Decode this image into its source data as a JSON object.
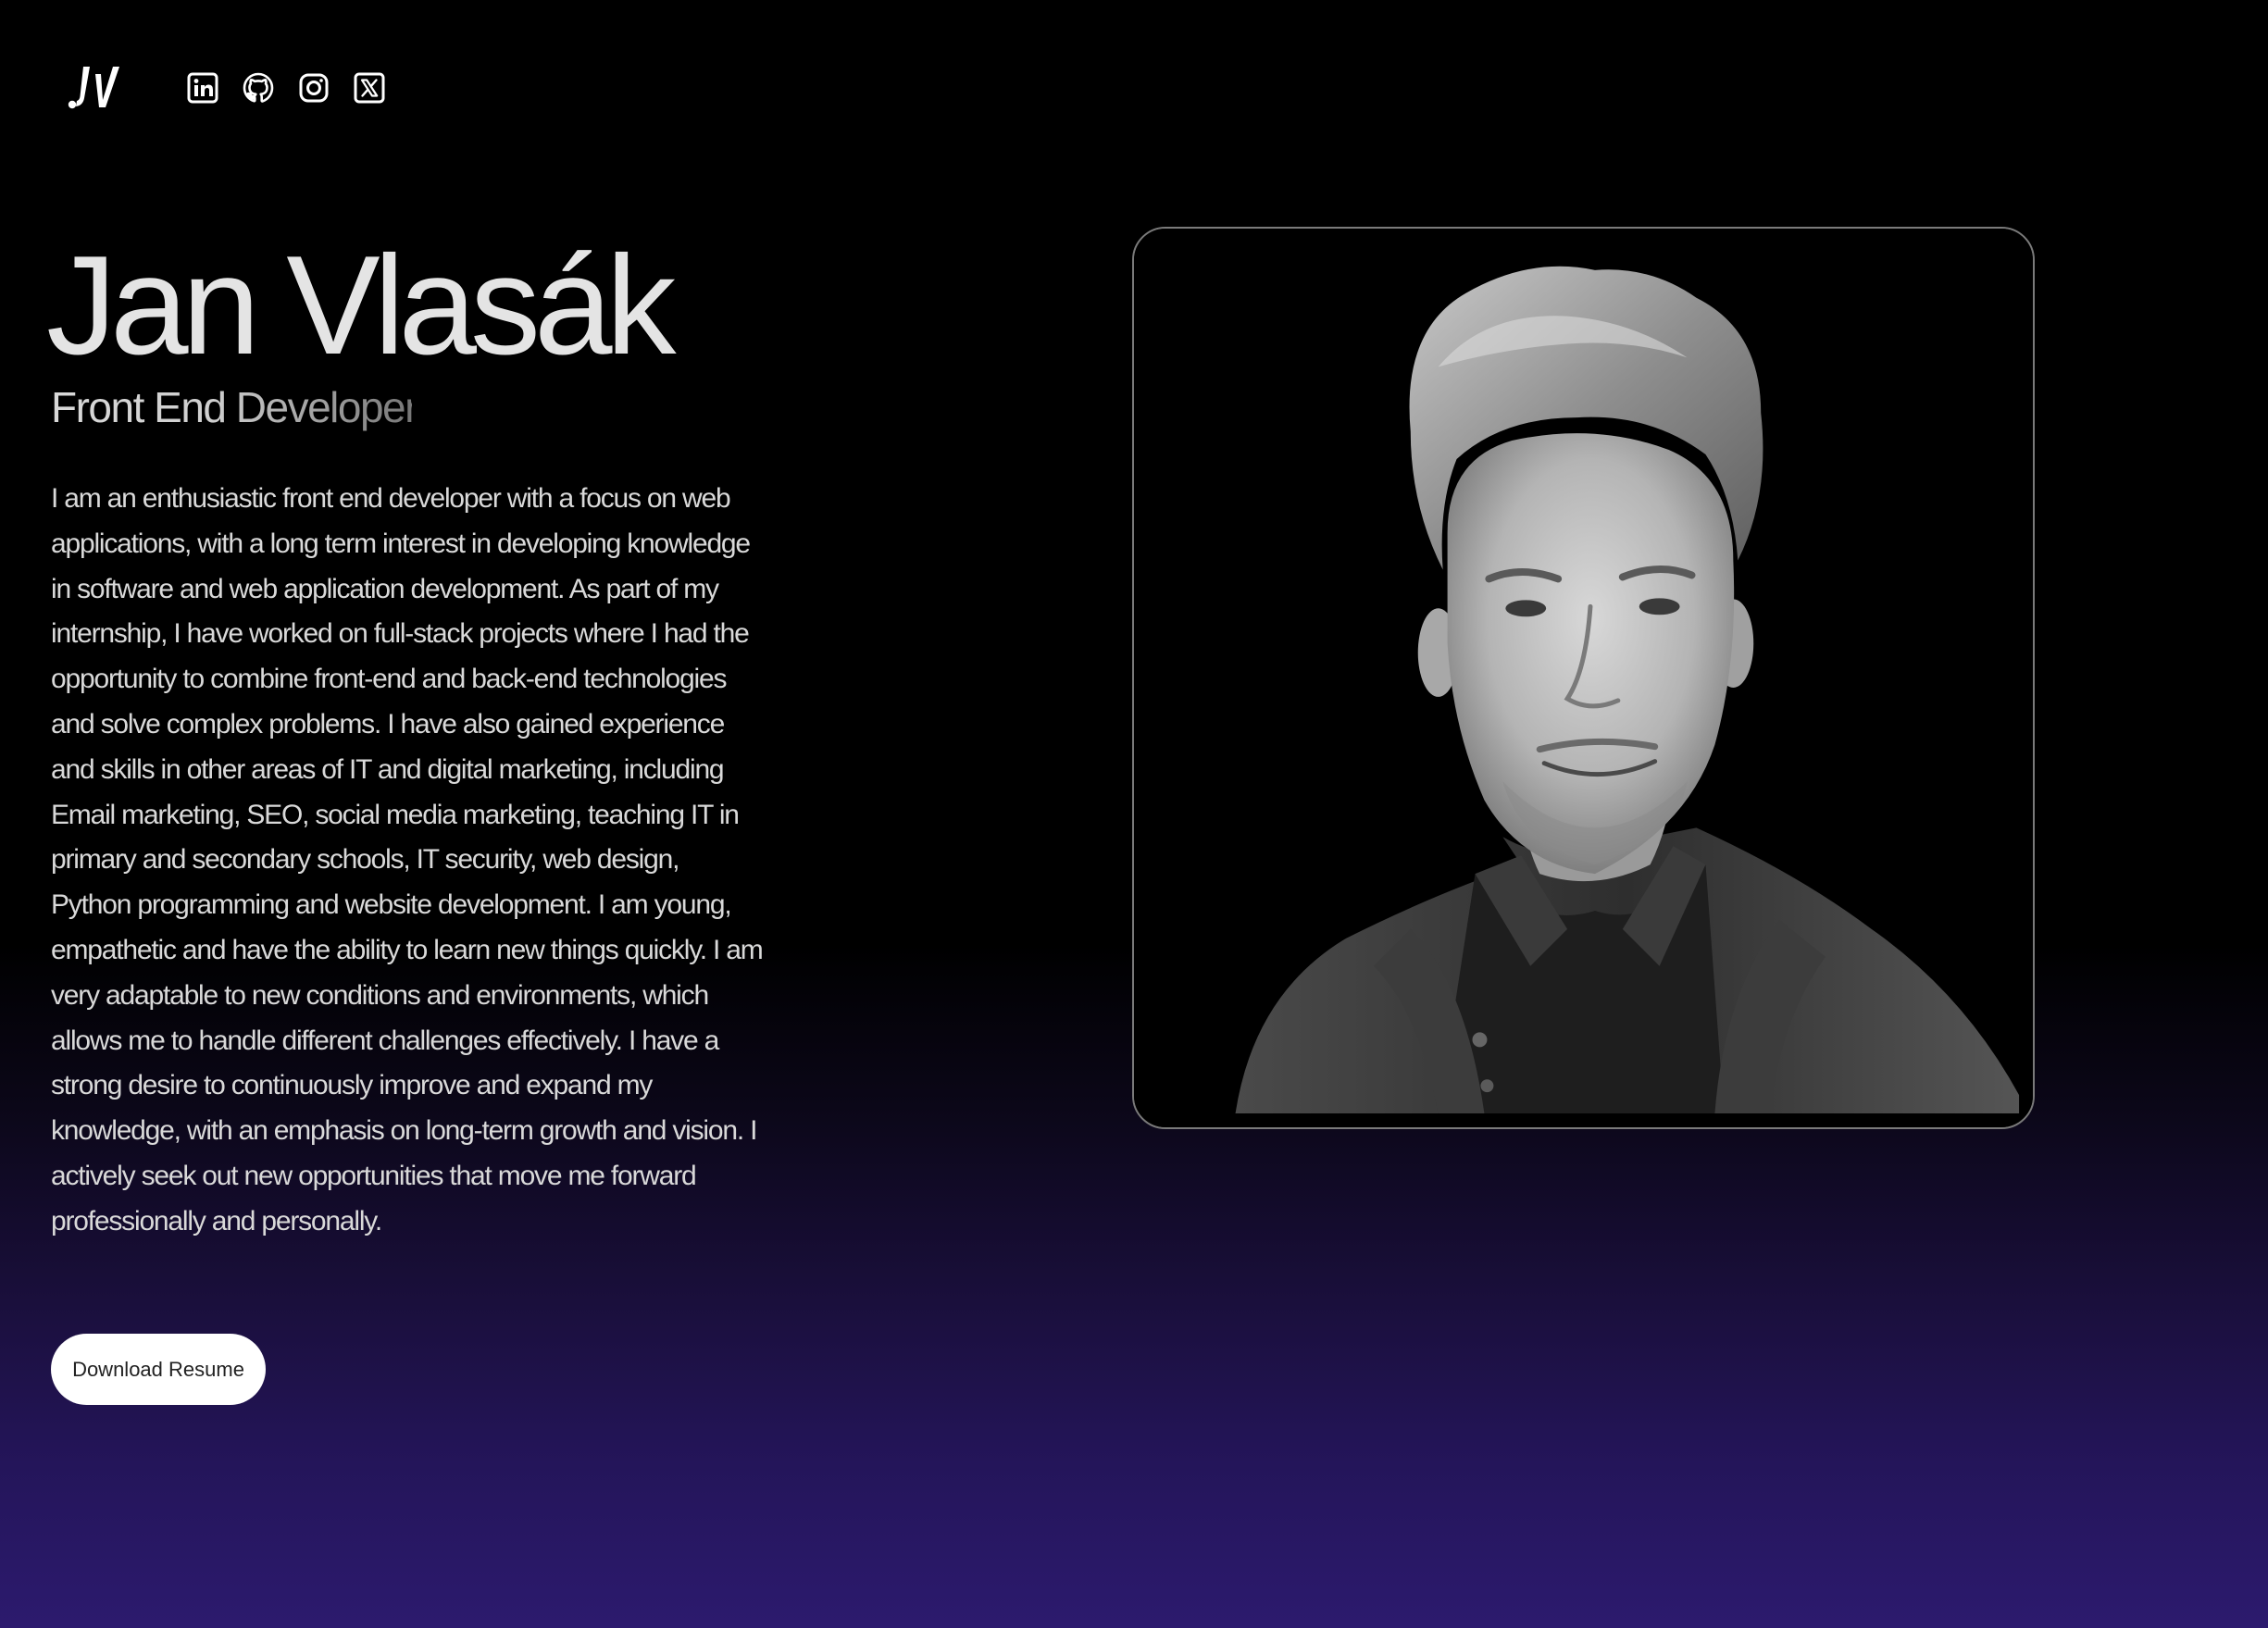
{
  "header": {
    "logo_icon": "jv-monogram-logo",
    "socials": [
      {
        "icon": "linkedin-icon",
        "name": "LinkedIn"
      },
      {
        "icon": "github-icon",
        "name": "GitHub"
      },
      {
        "icon": "instagram-icon",
        "name": "Instagram"
      },
      {
        "icon": "x-icon",
        "name": "X"
      }
    ]
  },
  "hero": {
    "name": "Jan Vlasák",
    "role": "Front End Developer",
    "bio": "I am an enthusiastic front end developer with a focus on web applications, with a long term interest in developing knowledge in software and web application development. As part of my internship, I have worked on full-stack projects where I had the opportunity to combine front-end and back-end technologies and solve complex problems. I have also gained experience and skills in other areas of IT and digital marketing, including Email marketing, SEO, social media marketing, teaching IT in primary and secondary schools, IT security, web design, Python programming and website development. I am young, empathetic and have the ability to learn new things quickly. I am very adaptable to new conditions and environments, which allows me to handle different challenges effectively. I have a strong desire to continuously improve and expand my knowledge, with an emphasis on long-term growth and vision. I actively seek out new opportunities that move me forward professionally and personally.",
    "button_label": "Download Resume"
  },
  "photo": {
    "subject": "portrait-photo"
  },
  "colors": {
    "background_top": "#000000",
    "background_bottom": "#2c1a6e",
    "text": "#d9d9d9",
    "button_bg": "#ffffff"
  }
}
